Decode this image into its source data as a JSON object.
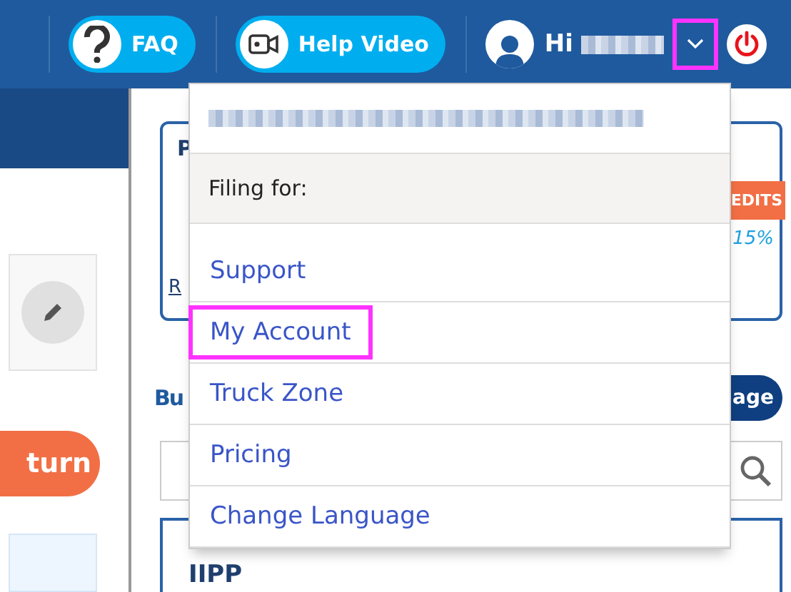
{
  "header": {
    "buttons": [
      {
        "kind": "faq",
        "label": "FAQ"
      },
      {
        "kind": "video",
        "label": "Help Video"
      }
    ],
    "greeting": "Hi",
    "menu_toggle_highlighted": true
  },
  "left_panel": {
    "action_button": "turn"
  },
  "main": {
    "card": {
      "title": "P",
      "link": "R",
      "badge": "EDITS",
      "percent": "15%"
    },
    "section_title": "Bu",
    "section_button": "age",
    "list_item": {
      "code": "IIPP"
    }
  },
  "dropdown": {
    "filing_label": "Filing for:",
    "items": [
      {
        "label": "Support",
        "highlighted": false
      },
      {
        "label": "My Account",
        "highlighted": true
      },
      {
        "label": "Truck Zone",
        "highlighted": false
      },
      {
        "label": "Pricing",
        "highlighted": false
      },
      {
        "label": "Change Language",
        "highlighted": false
      }
    ]
  }
}
